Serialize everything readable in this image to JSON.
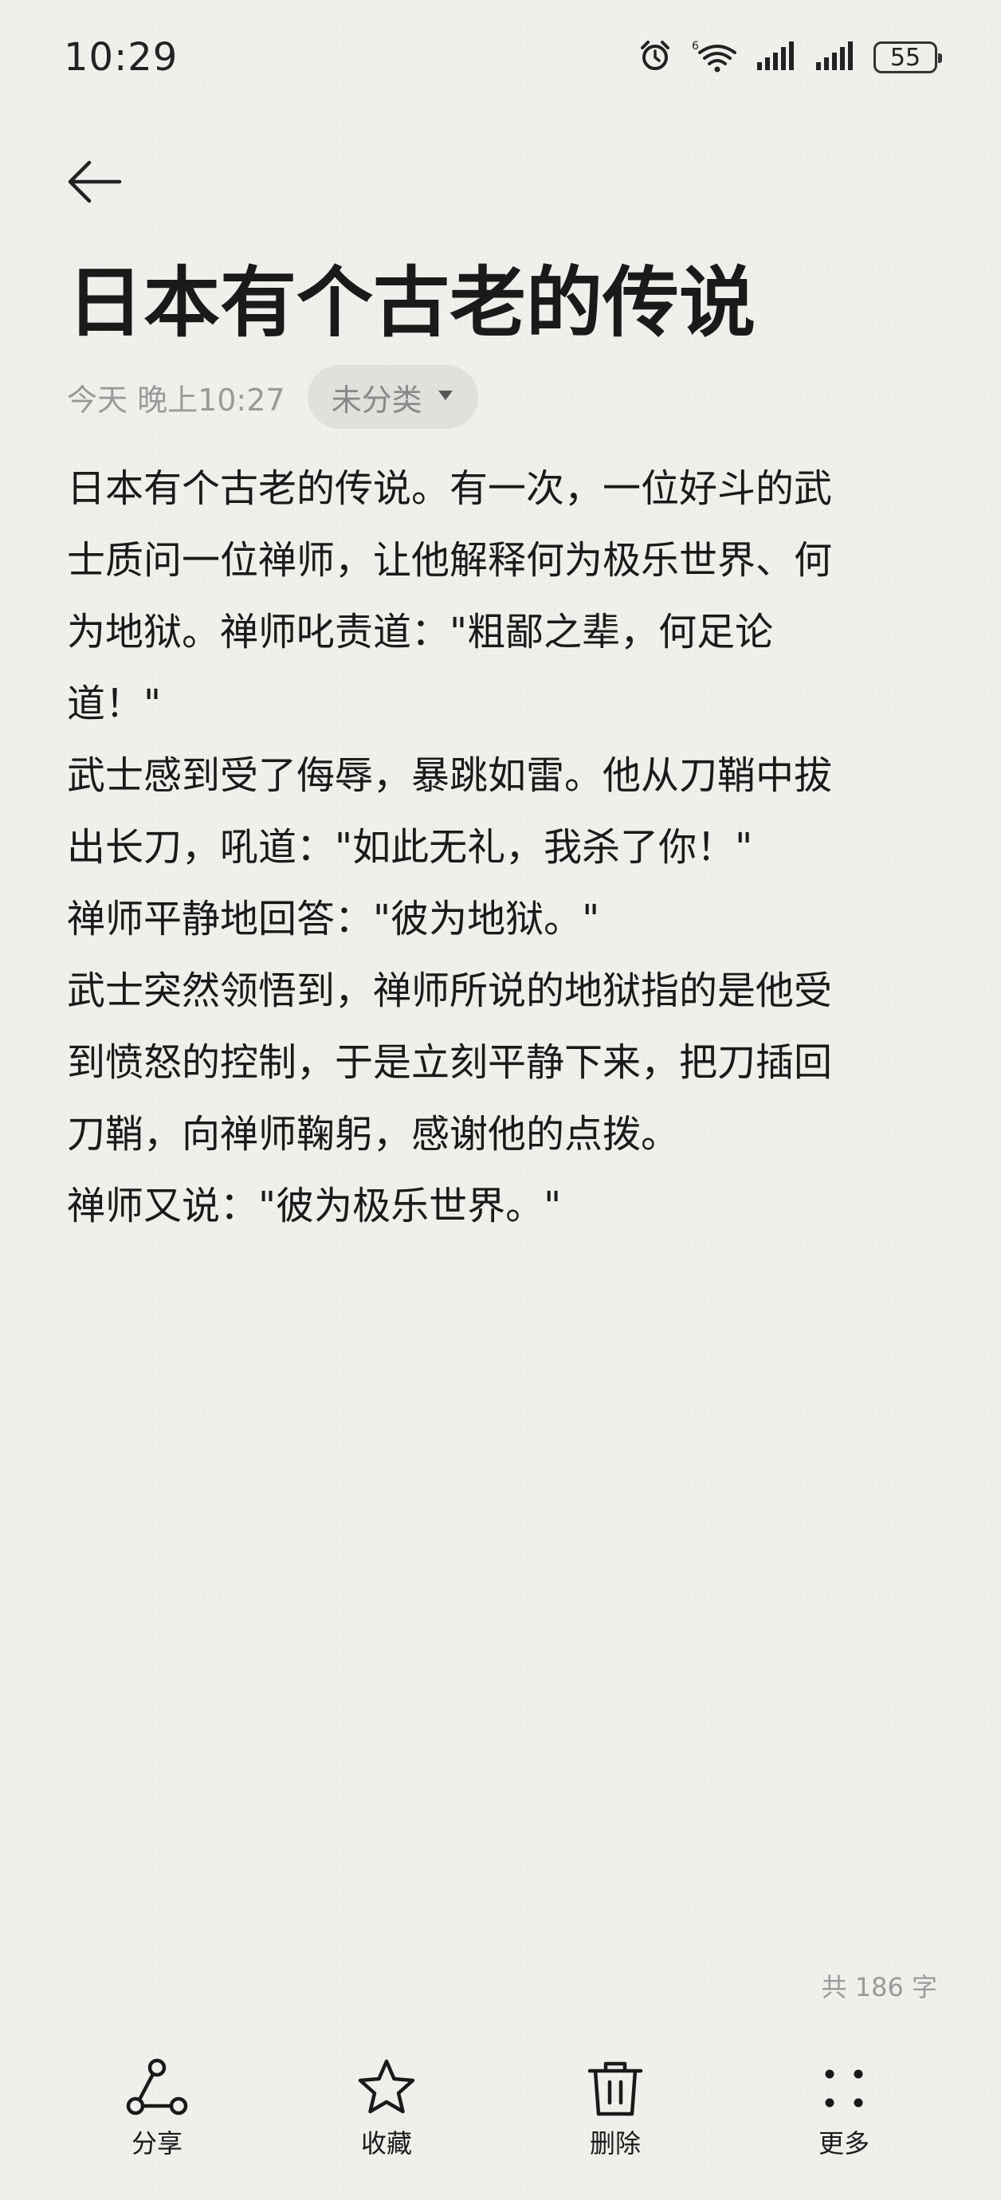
{
  "status_bar": {
    "time": "10:29",
    "battery": "55",
    "icons": [
      "alarm-icon",
      "wifi-icon",
      "signal-icon",
      "signal-icon",
      "battery-icon"
    ]
  },
  "note": {
    "title": "日本有个古老的传说",
    "date": "今天 晚上10:27",
    "category": "未分类",
    "lines": [
      "日本有个古老的传说。有一次，一位好斗的武",
      "士质问一位禅师，让他解释何为极乐世界、何",
      "为地狱。禅师叱责道：\"粗鄙之辈，何足论",
      "道！\"",
      "武士感到受了侮辱，暴跳如雷。他从刀鞘中拔",
      "出长刀，吼道：\"如此无礼，我杀了你！\"",
      "禅师平静地回答：\"彼为地狱。\"",
      "武士突然领悟到，禅师所说的地狱指的是他受",
      "到愤怒的控制，于是立刻平静下来，把刀插回",
      "刀鞘，向禅师鞠躬，感谢他的点拨。",
      "禅师又说：\"彼为极乐世界。\""
    ],
    "word_count": "共 186 字"
  },
  "toolbar": {
    "share": "分享",
    "favorite": "收藏",
    "delete": "删除",
    "more": "更多"
  },
  "colors": {
    "background": "#efefeb",
    "text": "#1a1a1a",
    "secondary_text": "#9a9a9a"
  }
}
